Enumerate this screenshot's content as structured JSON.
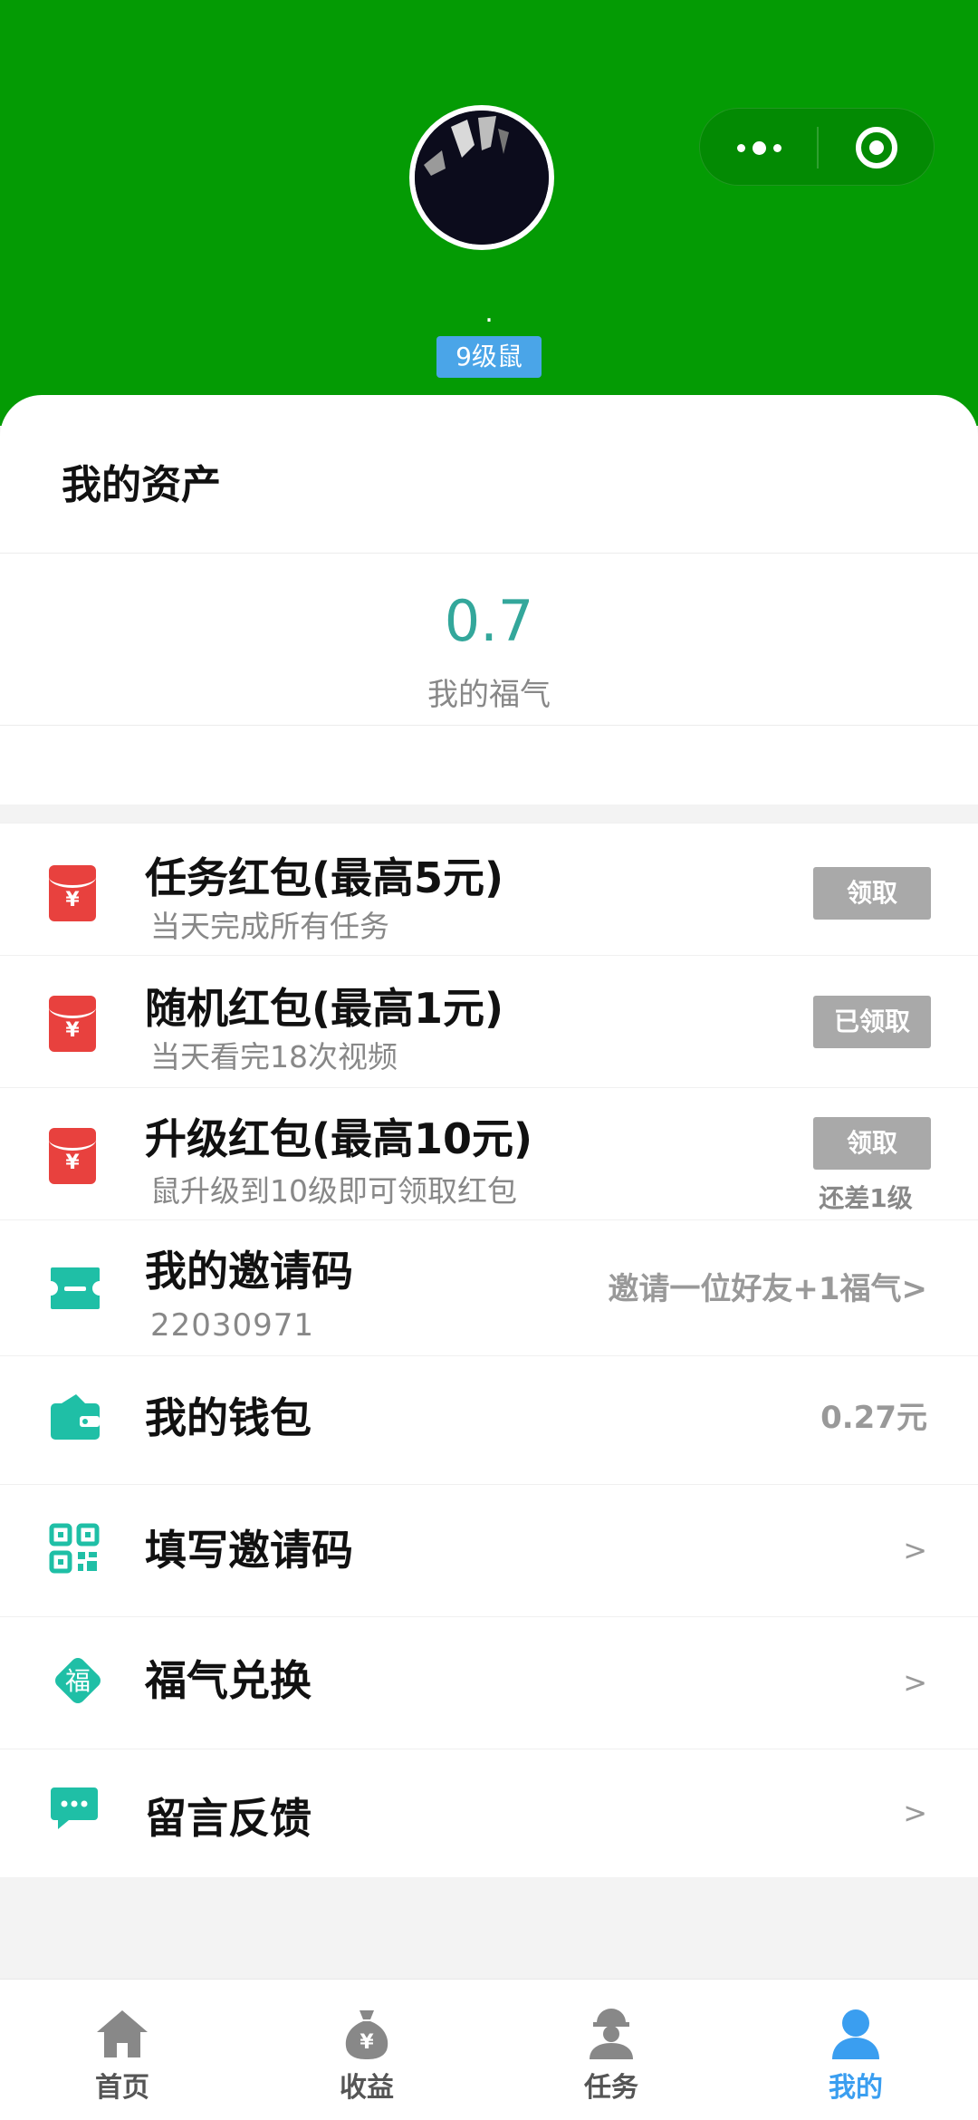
{
  "header": {
    "nickname": ".",
    "level_badge": "9级鼠"
  },
  "assets": {
    "title": "我的资产",
    "value": "0.7",
    "label": "我的福气"
  },
  "red_packets": [
    {
      "title": "任务红包(最高5元)",
      "subtitle": "当天完成所有任务",
      "button": "领取"
    },
    {
      "title": "随机红包(最高1元)",
      "subtitle": "当天看完18次视频",
      "button": "已领取"
    },
    {
      "title": "升级红包(最高10元)",
      "subtitle": "鼠升级到10级即可领取红包",
      "button": "领取",
      "note": "还差1级"
    }
  ],
  "menu": {
    "invite_code": {
      "title": "我的邀请码",
      "code": "22030971",
      "right": "邀请一位好友+1福气>"
    },
    "wallet": {
      "title": "我的钱包",
      "right": "0.27元"
    },
    "fill_invite": {
      "title": "填写邀请码",
      "right": ">"
    },
    "exchange": {
      "title": "福气兑换",
      "right": ">"
    },
    "feedback": {
      "title": "留言反馈",
      "right": ">"
    }
  },
  "tabbar": [
    {
      "label": "首页",
      "icon": "home-icon"
    },
    {
      "label": "收益",
      "icon": "money-bag-icon"
    },
    {
      "label": "任务",
      "icon": "worker-icon"
    },
    {
      "label": "我的",
      "icon": "user-icon",
      "active": true
    }
  ],
  "colors": {
    "header_green": "#049b04",
    "accent_teal": "#33a79b",
    "icon_teal": "#1fbfa6",
    "red_packet": "#e8413e",
    "active_tab": "#3a9ef0"
  }
}
